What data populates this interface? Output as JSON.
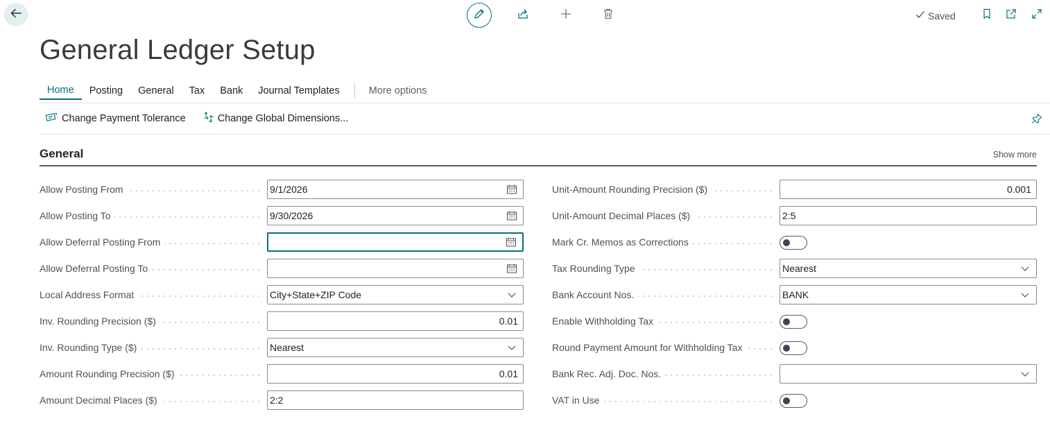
{
  "header": {
    "title": "General Ledger Setup",
    "saved_label": "Saved"
  },
  "tabs": [
    {
      "label": "Home",
      "active": true
    },
    {
      "label": "Posting"
    },
    {
      "label": "General"
    },
    {
      "label": "Tax"
    },
    {
      "label": "Bank"
    },
    {
      "label": "Journal Templates"
    }
  ],
  "more_options_label": "More options",
  "actions": [
    {
      "label": "Change Payment Tolerance",
      "icon": "payment-tolerance-icon"
    },
    {
      "label": "Change Global Dimensions...",
      "icon": "global-dimensions-icon"
    }
  ],
  "section": {
    "title": "General",
    "show_more": "Show more"
  },
  "left_fields": [
    {
      "label": "Allow Posting From",
      "value": "9/1/2026",
      "kind": "date"
    },
    {
      "label": "Allow Posting To",
      "value": "9/30/2026",
      "kind": "date"
    },
    {
      "label": "Allow Deferral Posting From",
      "value": "",
      "kind": "date",
      "focused": true
    },
    {
      "label": "Allow Deferral Posting To",
      "value": "",
      "kind": "date"
    },
    {
      "label": "Local Address Format",
      "value": "City+State+ZIP Code",
      "kind": "select"
    },
    {
      "label": "Inv. Rounding Precision ($)",
      "value": "0.01",
      "kind": "number"
    },
    {
      "label": "Inv. Rounding Type ($)",
      "value": "Nearest",
      "kind": "select"
    },
    {
      "label": "Amount Rounding Precision ($)",
      "value": "0.01",
      "kind": "number"
    },
    {
      "label": "Amount Decimal Places ($)",
      "value": "2:2",
      "kind": "text"
    }
  ],
  "right_fields": [
    {
      "label": "Unit-Amount Rounding Precision ($)",
      "value": "0.001",
      "kind": "number"
    },
    {
      "label": "Unit-Amount Decimal Places ($)",
      "value": "2:5",
      "kind": "text"
    },
    {
      "label": "Mark Cr. Memos as Corrections",
      "value": false,
      "kind": "toggle"
    },
    {
      "label": "Tax Rounding Type",
      "value": "Nearest",
      "kind": "select"
    },
    {
      "label": "Bank Account Nos.",
      "value": "BANK",
      "kind": "select"
    },
    {
      "label": "Enable Withholding Tax",
      "value": false,
      "kind": "toggle"
    },
    {
      "label": "Round Payment Amount for Withholding Tax",
      "value": false,
      "kind": "toggle"
    },
    {
      "label": "Bank Rec. Adj. Doc. Nos.",
      "value": "",
      "kind": "select"
    },
    {
      "label": "VAT in Use",
      "value": false,
      "kind": "toggle"
    }
  ],
  "colors": {
    "accent": "#00727a",
    "toggle_off": "#3d4654"
  }
}
